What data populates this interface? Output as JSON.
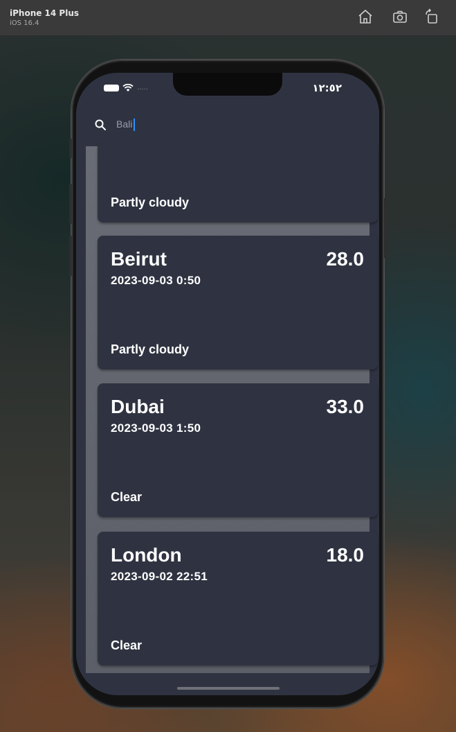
{
  "simulator": {
    "device_name": "iPhone 14 Plus",
    "os_version": "iOS 16.4",
    "buttons": [
      {
        "name": "home-icon"
      },
      {
        "name": "screenshot-icon"
      },
      {
        "name": "rotate-icon"
      }
    ]
  },
  "status_bar": {
    "time": "١٢:٥٢",
    "signal_dots": "....."
  },
  "search": {
    "icon": "search-icon",
    "value": "Bali",
    "caret_color": "#2f8fff"
  },
  "cards": [
    {
      "city": "",
      "temp": "",
      "time": "",
      "condition": "Partly cloudy"
    },
    {
      "city": "Beirut",
      "temp": "28.0",
      "time": "2023-09-03 0:50",
      "condition": "Partly cloudy"
    },
    {
      "city": "Dubai",
      "temp": "33.0",
      "time": "2023-09-03 1:50",
      "condition": "Clear"
    },
    {
      "city": "London",
      "temp": "18.0",
      "time": "2023-09-02 22:51",
      "condition": "Clear"
    }
  ],
  "colors": {
    "card_background": "#2f3341",
    "list_background": "#64676f",
    "text": "#ffffff"
  }
}
